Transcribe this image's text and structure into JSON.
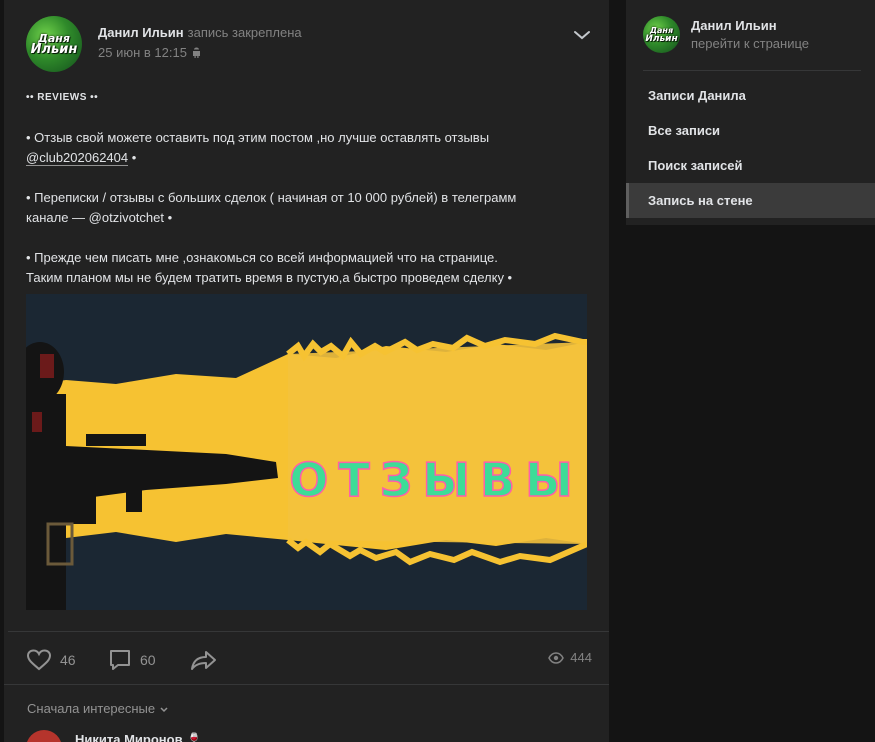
{
  "post": {
    "author": "Данил Ильин",
    "pinned_label": "запись закреплена",
    "date": "25 июн в 12:15",
    "avatar_text": [
      "Даня",
      "Ильин"
    ],
    "text": {
      "heading": "•• REVIEWS ••",
      "p1_a": "• Отзыв свой можете оставить под этим постом ,но лучше оставлять отзывы",
      "p1_link": "@club202062404",
      "p1_b": " •",
      "p2_a": "• Переписки / отзывы с больших сделок ( начиная от 10 000 рублей) в телеграмм",
      "p2_b": "канале — @otzivotchet •",
      "p3_a": "• Прежде чем писать мне ,ознакомься со всей информацией что на странице.",
      "p3_b": "Таким планом мы не будем тратить время в пустую,а быстро проведем сделку •"
    },
    "banner_text": "ОТЗЫВЫ",
    "likes": "46",
    "comments": "60",
    "views": "444"
  },
  "comments_section": {
    "sort_label": "Сначала интересные",
    "first_commenter": "Никита Миронов"
  },
  "sidebar": {
    "name": "Данил Ильин",
    "goto_label": "перейти к странице",
    "items": [
      {
        "label": "Записи Данила"
      },
      {
        "label": "Все записи"
      },
      {
        "label": "Поиск записей"
      },
      {
        "label": "Запись на стене"
      }
    ]
  },
  "colors": {
    "background": "#141414",
    "panel": "#222222",
    "text": "#e1e3e6",
    "muted": "#828282",
    "banner_yellow": "#f6c232",
    "banner_text": "#3ddc97"
  }
}
